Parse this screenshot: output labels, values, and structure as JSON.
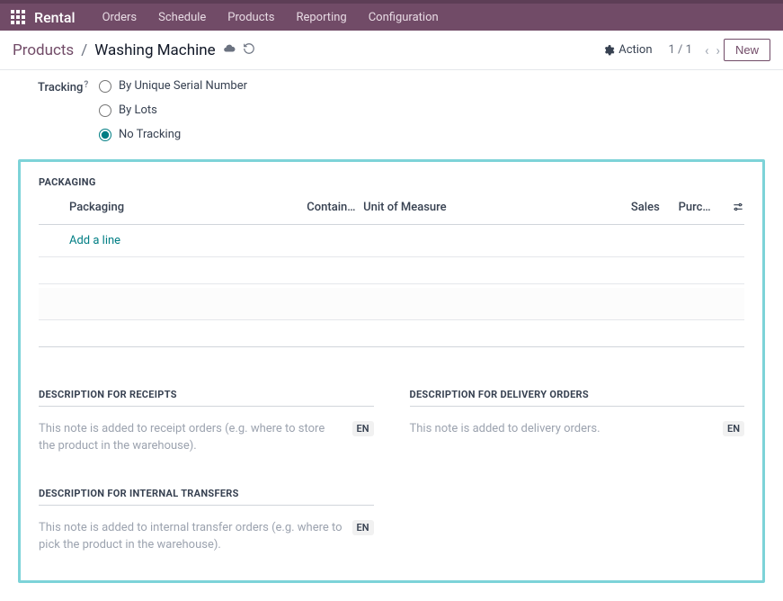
{
  "topbar": {
    "brand": "Rental",
    "nav": [
      "Orders",
      "Schedule",
      "Products",
      "Reporting",
      "Configuration"
    ]
  },
  "controlbar": {
    "breadcrumb_root": "Products",
    "breadcrumb_sep": "/",
    "breadcrumb_current": "Washing Machine",
    "action_label": "Action",
    "pager": "1 / 1",
    "new_label": "New"
  },
  "tracking": {
    "label": "Tracking",
    "options": [
      {
        "label": "By Unique Serial Number",
        "checked": false
      },
      {
        "label": "By Lots",
        "checked": false
      },
      {
        "label": "No Tracking",
        "checked": true
      }
    ]
  },
  "packaging": {
    "title": "PACKAGING",
    "headers": {
      "packaging": "Packaging",
      "contained": "Contain…",
      "uom": "Unit of Measure",
      "sales": "Sales",
      "purchase": "Purc…"
    },
    "add_line": "Add a line"
  },
  "descriptions": {
    "receipts": {
      "title": "DESCRIPTION FOR RECEIPTS",
      "placeholder": "This note is added to receipt orders (e.g. where to store the product in the warehouse).",
      "lang": "EN"
    },
    "delivery": {
      "title": "DESCRIPTION FOR DELIVERY ORDERS",
      "placeholder": "This note is added to delivery orders.",
      "lang": "EN"
    },
    "internal": {
      "title": "DESCRIPTION FOR INTERNAL TRANSFERS",
      "placeholder": "This note is added to internal transfer orders (e.g. where to pick the product in the warehouse).",
      "lang": "EN"
    }
  }
}
